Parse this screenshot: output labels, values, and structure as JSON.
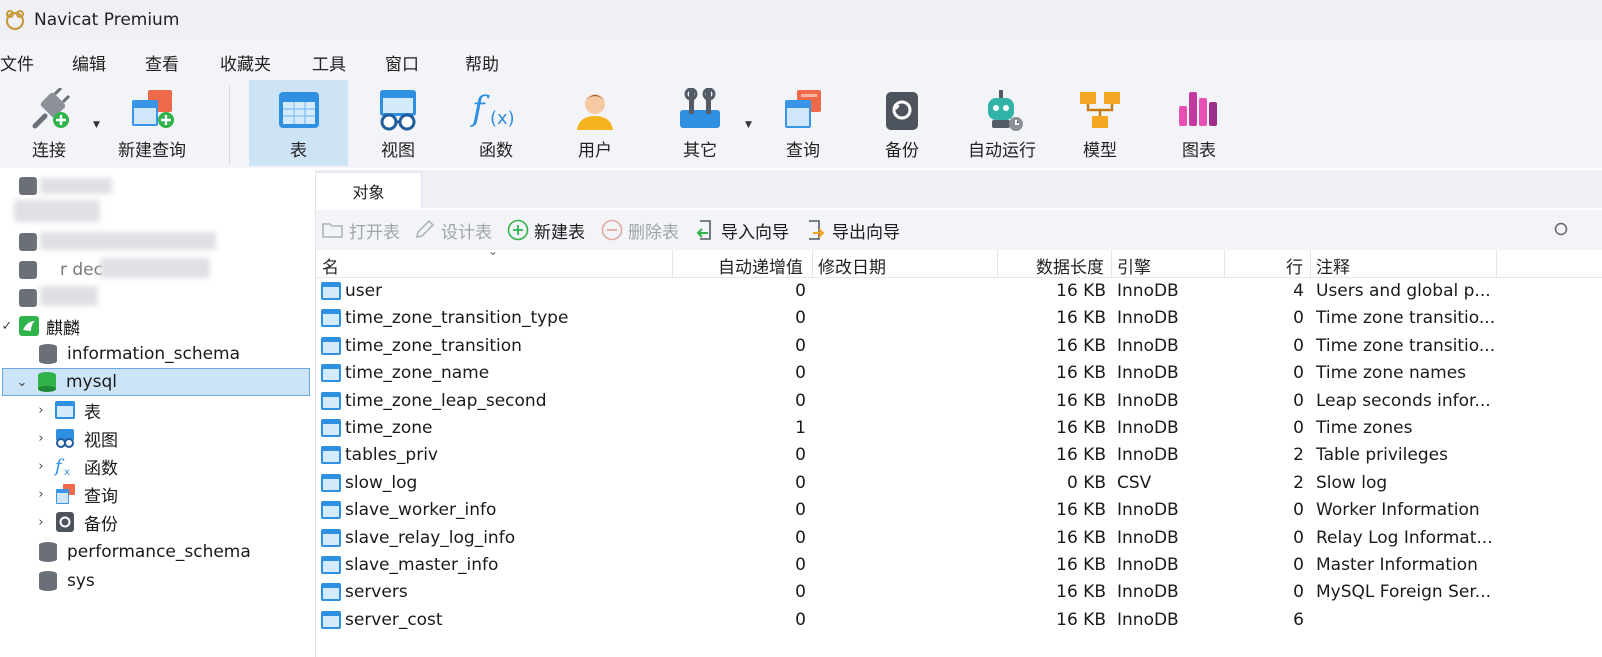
{
  "app": {
    "title": "Navicat Premium"
  },
  "menu": [
    "文件",
    "编辑",
    "查看",
    "收藏夹",
    "工具",
    "窗口",
    "帮助"
  ],
  "toolbar": {
    "connect": "连接",
    "new_query": "新建查询",
    "table": "表",
    "view": "视图",
    "function": "函数",
    "user": "用户",
    "other": "其它",
    "query": "查询",
    "backup": "备份",
    "automation": "自动运行",
    "model": "模型",
    "chart": "图表"
  },
  "tree": {
    "partial_label": "r dec",
    "connection": "麒麟",
    "databases": {
      "information_schema": "information_schema",
      "mysql": "mysql",
      "performance_schema": "performance_schema",
      "sys": "sys"
    },
    "mysql_children": {
      "tables": "表",
      "views": "视图",
      "functions": "函数",
      "queries": "查询",
      "backups": "备份"
    }
  },
  "tabs": {
    "objects": "对象"
  },
  "object_toolbar": {
    "open_table": "打开表",
    "design_table": "设计表",
    "new_table": "新建表",
    "delete_table": "删除表",
    "import_wizard": "导入向导",
    "export_wizard": "导出向导"
  },
  "grid": {
    "headers": {
      "name": "名",
      "auto_increment": "自动递增值",
      "modified": "修改日期",
      "data_length": "数据长度",
      "engine": "引擎",
      "rows": "行",
      "comment": "注释"
    },
    "rows": [
      {
        "name": "user",
        "auto_inc": "0",
        "modified": "",
        "data_length": "16 KB",
        "engine": "InnoDB",
        "rows": "4",
        "comment": "Users and global p..."
      },
      {
        "name": "time_zone_transition_type",
        "auto_inc": "0",
        "modified": "",
        "data_length": "16 KB",
        "engine": "InnoDB",
        "rows": "0",
        "comment": "Time zone transitio..."
      },
      {
        "name": "time_zone_transition",
        "auto_inc": "0",
        "modified": "",
        "data_length": "16 KB",
        "engine": "InnoDB",
        "rows": "0",
        "comment": "Time zone transitio..."
      },
      {
        "name": "time_zone_name",
        "auto_inc": "0",
        "modified": "",
        "data_length": "16 KB",
        "engine": "InnoDB",
        "rows": "0",
        "comment": "Time zone names"
      },
      {
        "name": "time_zone_leap_second",
        "auto_inc": "0",
        "modified": "",
        "data_length": "16 KB",
        "engine": "InnoDB",
        "rows": "0",
        "comment": "Leap seconds infor..."
      },
      {
        "name": "time_zone",
        "auto_inc": "1",
        "modified": "",
        "data_length": "16 KB",
        "engine": "InnoDB",
        "rows": "0",
        "comment": "Time zones"
      },
      {
        "name": "tables_priv",
        "auto_inc": "0",
        "modified": "",
        "data_length": "16 KB",
        "engine": "InnoDB",
        "rows": "2",
        "comment": "Table privileges"
      },
      {
        "name": "slow_log",
        "auto_inc": "0",
        "modified": "",
        "data_length": "0 KB",
        "engine": "CSV",
        "rows": "2",
        "comment": "Slow log"
      },
      {
        "name": "slave_worker_info",
        "auto_inc": "0",
        "modified": "",
        "data_length": "16 KB",
        "engine": "InnoDB",
        "rows": "0",
        "comment": "Worker Information"
      },
      {
        "name": "slave_relay_log_info",
        "auto_inc": "0",
        "modified": "",
        "data_length": "16 KB",
        "engine": "InnoDB",
        "rows": "0",
        "comment": "Relay Log Informat..."
      },
      {
        "name": "slave_master_info",
        "auto_inc": "0",
        "modified": "",
        "data_length": "16 KB",
        "engine": "InnoDB",
        "rows": "0",
        "comment": "Master Information"
      },
      {
        "name": "servers",
        "auto_inc": "0",
        "modified": "",
        "data_length": "16 KB",
        "engine": "InnoDB",
        "rows": "0",
        "comment": "MySQL Foreign Ser..."
      },
      {
        "name": "server_cost",
        "auto_inc": "0",
        "modified": "",
        "data_length": "16 KB",
        "engine": "InnoDB",
        "rows": "6",
        "comment": ""
      }
    ]
  },
  "colors": {
    "accent_selected": "#cde3f6",
    "tree_selected_border": "#6aa8de",
    "table_icon_blue": "#2f8fe0",
    "connection_green": "#2fb34a"
  }
}
